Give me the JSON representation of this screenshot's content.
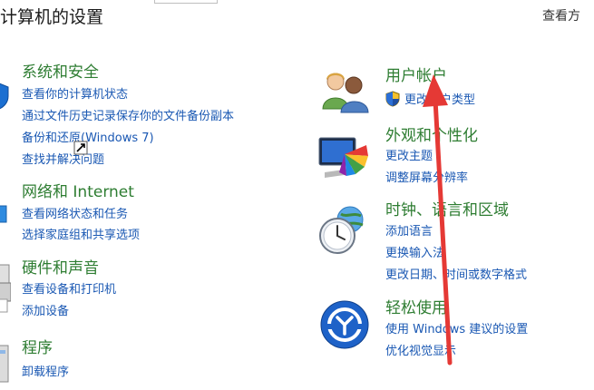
{
  "header": {
    "title": "计算机的设置",
    "view_by": "查看方"
  },
  "left": [
    {
      "title": "系统和安全",
      "icon": "shield-icon",
      "links": [
        "查看你的计算机状态",
        "通过文件历史记录保存你的文件备份副本",
        "备份和还原(Windows 7)",
        "查找并解决问题"
      ]
    },
    {
      "title": "网络和 Internet",
      "icon": "network-icon",
      "links": [
        "查看网络状态和任务",
        "选择家庭组和共享选项"
      ]
    },
    {
      "title": "硬件和声音",
      "icon": "printer-icon",
      "links": [
        "查看设备和打印机",
        "添加设备"
      ]
    },
    {
      "title": "程序",
      "icon": "programs-icon",
      "links": [
        "卸载程序"
      ]
    }
  ],
  "right": [
    {
      "title": "用户帐户",
      "icon": "users-icon",
      "links": [
        "更改帐户类型"
      ]
    },
    {
      "title": "外观和个性化",
      "icon": "monitor-palette-icon",
      "links": [
        "更改主题",
        "调整屏幕分辨率"
      ]
    },
    {
      "title": "时钟、语言和区域",
      "icon": "clock-globe-icon",
      "links": [
        "添加语言",
        "更换输入法",
        "更改日期、时间或数字格式"
      ]
    },
    {
      "title": "轻松使用",
      "icon": "ease-of-access-icon",
      "links": [
        "使用 Windows 建议的设置",
        "优化视觉显示"
      ]
    }
  ],
  "colors": {
    "category": "#2e7d32",
    "link": "#1a58b3",
    "annotation_arrow": "#e53935"
  }
}
